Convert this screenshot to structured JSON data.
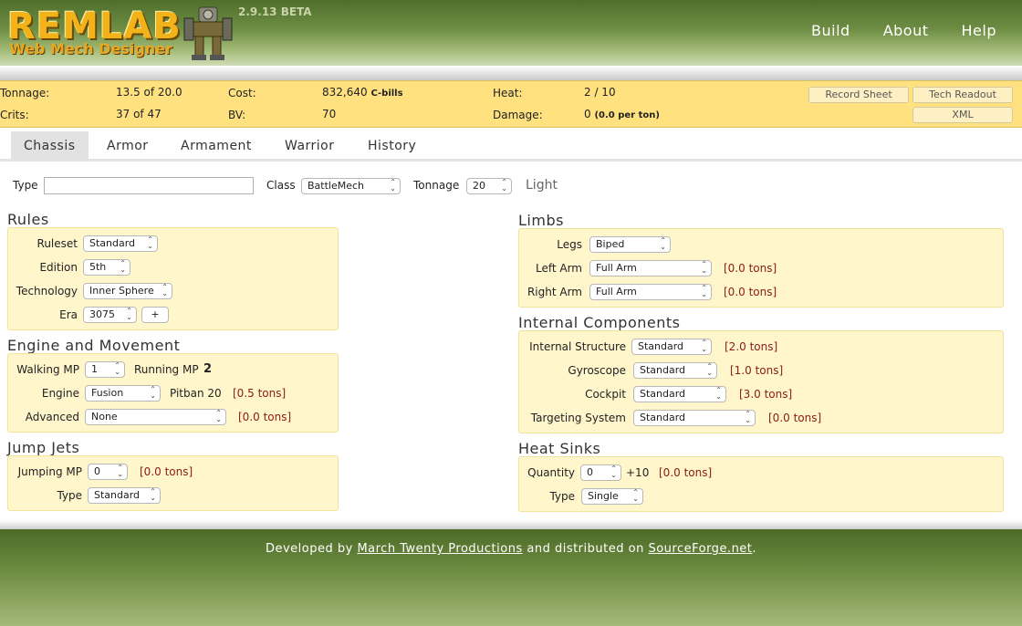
{
  "app": {
    "logo_main": "REMLAB",
    "logo_sub": "Web Mech Designer",
    "version": "2.9.13 BETA"
  },
  "nav": {
    "build": "Build",
    "about": "About",
    "help": "Help"
  },
  "summary": {
    "tonnage_label": "Tonnage:",
    "tonnage_value": "13.5 of 20.0",
    "crits_label": "Crits:",
    "crits_value": "37 of 47",
    "cost_label": "Cost:",
    "cost_value": "832,640",
    "cost_unit": "C-bills",
    "bv_label": "BV:",
    "bv_value": "70",
    "heat_label": "Heat:",
    "heat_value": "2 / 10",
    "damage_label": "Damage:",
    "damage_value": "0",
    "damage_detail": "(0.0 per ton)",
    "record_sheet": "Record Sheet",
    "tech_readout": "Tech Readout",
    "xml": "XML"
  },
  "tabs": [
    "Chassis",
    "Armor",
    "Armament",
    "Warrior",
    "History"
  ],
  "top_row": {
    "type_label": "Type",
    "type_value": "",
    "class_label": "Class",
    "class_value": "BattleMech",
    "tonnage_label": "Tonnage",
    "tonnage_value": "20",
    "weight_class": "Light"
  },
  "rules": {
    "title": "Rules",
    "ruleset_label": "Ruleset",
    "ruleset_value": "Standard",
    "edition_label": "Edition",
    "edition_value": "5th",
    "technology_label": "Technology",
    "technology_value": "Inner Sphere",
    "era_label": "Era",
    "era_value": "3075",
    "era_add": "+"
  },
  "engine": {
    "title": "Engine and Movement",
    "walking_label": "Walking MP",
    "walking_value": "1",
    "running_label": "Running MP",
    "running_value": "2",
    "engine_label": "Engine",
    "engine_value": "Fusion",
    "engine_name": "Pitban 20",
    "engine_tons": "[0.5 tons]",
    "advanced_label": "Advanced",
    "advanced_value": "None",
    "advanced_tons": "[0.0 tons]"
  },
  "jump": {
    "title": "Jump Jets",
    "jumping_label": "Jumping MP",
    "jumping_value": "0",
    "jumping_tons": "[0.0 tons]",
    "type_label": "Type",
    "type_value": "Standard"
  },
  "limbs": {
    "title": "Limbs",
    "legs_label": "Legs",
    "legs_value": "Biped",
    "left_arm_label": "Left Arm",
    "left_arm_value": "Full Arm",
    "left_arm_tons": "[0.0 tons]",
    "right_arm_label": "Right Arm",
    "right_arm_value": "Full Arm",
    "right_arm_tons": "[0.0 tons]"
  },
  "internal": {
    "title": "Internal Components",
    "structure_label": "Internal Structure",
    "structure_value": "Standard",
    "structure_tons": "[2.0 tons]",
    "gyro_label": "Gyroscope",
    "gyro_value": "Standard",
    "gyro_tons": "[1.0 tons]",
    "cockpit_label": "Cockpit",
    "cockpit_value": "Standard",
    "cockpit_tons": "[3.0 tons]",
    "targeting_label": "Targeting System",
    "targeting_value": "Standard",
    "targeting_tons": "[0.0 tons]"
  },
  "heat_sinks": {
    "title": "Heat Sinks",
    "quantity_label": "Quantity",
    "quantity_value": "0",
    "quantity_bonus": "+10",
    "quantity_tons": "[0.0 tons]",
    "type_label": "Type",
    "type_value": "Single"
  },
  "footer": {
    "prefix": "Developed by",
    "link1": "March Twenty Productions",
    "middle": "and distributed on",
    "link2": "SourceForge.net",
    "suffix": "."
  }
}
